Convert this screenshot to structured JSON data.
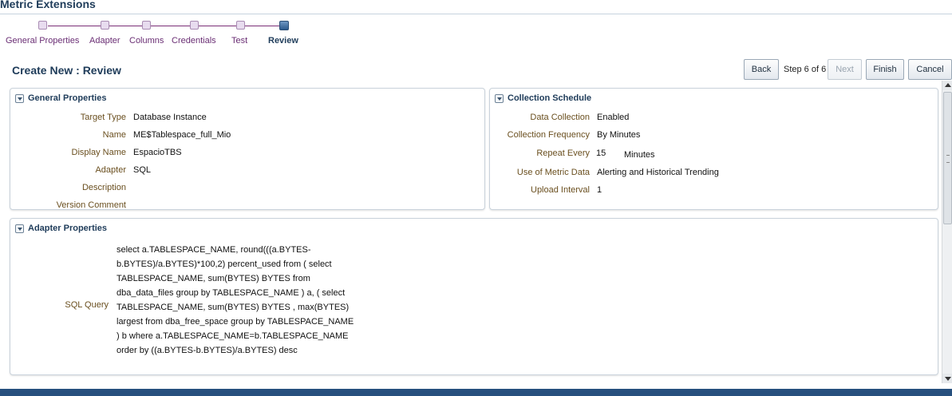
{
  "app": {
    "title": "Metric Extensions"
  },
  "train": {
    "steps": [
      {
        "label": "General Properties"
      },
      {
        "label": "Adapter"
      },
      {
        "label": "Columns"
      },
      {
        "label": "Credentials"
      },
      {
        "label": "Test"
      },
      {
        "label": "Review"
      }
    ],
    "current_step": "Review"
  },
  "header": {
    "title": "Create New : Review",
    "back_label": "Back",
    "step_text": "Step 6 of 6",
    "next_label": "Next",
    "finish_label": "Finish",
    "cancel_label": "Cancel"
  },
  "general_properties": {
    "title": "General Properties",
    "target_type_label": "Target Type",
    "target_type_value": "Database Instance",
    "name_label": "Name",
    "name_value": "ME$Tablespace_full_Mio",
    "display_name_label": "Display Name",
    "display_name_value": "EspacioTBS",
    "adapter_label": "Adapter",
    "adapter_value": "SQL",
    "description_label": "Description",
    "description_value": "",
    "version_comment_label": "Version Comment",
    "version_comment_value": ""
  },
  "collection_schedule": {
    "title": "Collection Schedule",
    "data_collection_label": "Data Collection",
    "data_collection_value": "Enabled",
    "frequency_label": "Collection Frequency",
    "frequency_value": "By Minutes",
    "repeat_label": "Repeat Every",
    "repeat_value": "15",
    "repeat_unit": "Minutes",
    "use_label": "Use of Metric Data",
    "use_value": "Alerting and Historical Trending",
    "upload_label": "Upload Interval",
    "upload_value": "1"
  },
  "adapter_properties": {
    "title": "Adapter Properties",
    "sql_label": "SQL Query",
    "sql_value": "select a.TABLESPACE_NAME, round(((a.BYTES-b.BYTES)/a.BYTES)*100,2) percent_used from ( select TABLESPACE_NAME, sum(BYTES) BYTES from dba_data_files group by TABLESPACE_NAME ) a, ( select TABLESPACE_NAME, sum(BYTES) BYTES , max(BYTES) largest from dba_free_space group by TABLESPACE_NAME ) b where a.TABLESPACE_NAME=b.TABLESPACE_NAME order by ((a.BYTES-b.BYTES)/a.BYTES) desc"
  }
}
